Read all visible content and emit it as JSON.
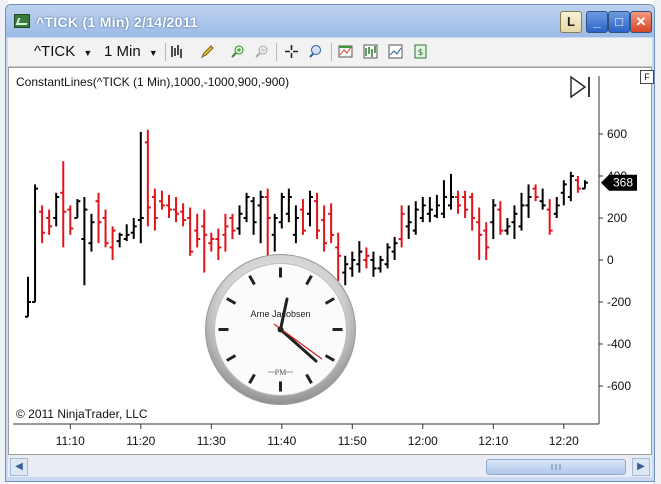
{
  "window": {
    "title": "^TICK (1 Min)  2/14/2011",
    "buttons": {
      "l": "L",
      "minimize": "_",
      "maximize": "□",
      "close": "✕"
    }
  },
  "toolbar": {
    "instrument": "^TICK",
    "interval": "1 Min",
    "icons": [
      "bar-type-icon",
      "drawing-pencil-icon",
      "zoom-in-icon",
      "zoom-out-icon",
      "crosshair-icon",
      "magnifier-icon",
      "indicators-icon",
      "strategies-icon",
      "chart-properties-icon",
      "data-box-icon"
    ]
  },
  "chart": {
    "indicator_label": "ConstantLines(^TICK  (1  Min),1000,-1000,900,-900)",
    "copyright": "© 2011 NinjaTrader, LLC",
    "f_button": "F",
    "last_price_label": "368",
    "play_icon": "play-to-end-icon"
  },
  "clock": {
    "brand": "Arne Jacobsen",
    "meridiem": "PM"
  },
  "colors": {
    "up_bar": "#000000",
    "down_bar": "#e0141b",
    "last_price_bg": "#000000"
  },
  "chart_data": {
    "type": "bar",
    "ylim": [
      -800,
      800
    ],
    "yticks": [
      600,
      400,
      200,
      0,
      -200,
      -400,
      -600
    ],
    "y_tick_labels": [
      "600",
      "400",
      "200",
      "0",
      "-200",
      "-400",
      "-600"
    ],
    "x_tick_labels": [
      "11:10",
      "11:20",
      "11:30",
      "11:40",
      "11:50",
      "12:00",
      "12:10",
      "12:20"
    ],
    "ohlc": [
      {
        "x": 0,
        "o": -270,
        "h": -80,
        "l": -270,
        "c": -200,
        "up": true
      },
      {
        "x": 1,
        "o": -200,
        "h": 360,
        "l": -200,
        "c": 340,
        "up": true
      },
      {
        "x": 2,
        "o": 230,
        "h": 260,
        "l": 80,
        "c": 130,
        "up": false
      },
      {
        "x": 3,
        "o": 200,
        "h": 240,
        "l": 120,
        "c": 160,
        "up": false
      },
      {
        "x": 4,
        "o": 200,
        "h": 320,
        "l": 160,
        "c": 300,
        "up": true
      },
      {
        "x": 5,
        "o": 320,
        "h": 470,
        "l": 60,
        "c": 230,
        "up": false
      },
      {
        "x": 6,
        "o": 240,
        "h": 260,
        "l": 120,
        "c": 150,
        "up": false
      },
      {
        "x": 7,
        "o": 200,
        "h": 290,
        "l": 200,
        "c": 280,
        "up": true
      },
      {
        "x": 8,
        "o": 100,
        "h": 300,
        "l": -120,
        "c": 240,
        "up": true
      },
      {
        "x": 9,
        "o": 80,
        "h": 220,
        "l": 40,
        "c": 180,
        "up": true
      },
      {
        "x": 10,
        "o": 280,
        "h": 320,
        "l": 80,
        "c": 180,
        "up": false
      },
      {
        "x": 11,
        "o": 200,
        "h": 240,
        "l": 60,
        "c": 80,
        "up": false
      },
      {
        "x": 12,
        "o": 60,
        "h": 160,
        "l": 0,
        "c": 140,
        "up": false
      },
      {
        "x": 13,
        "o": 90,
        "h": 130,
        "l": 60,
        "c": 120,
        "up": true
      },
      {
        "x": 14,
        "o": 100,
        "h": 170,
        "l": 90,
        "c": 120,
        "up": true
      },
      {
        "x": 15,
        "o": 130,
        "h": 200,
        "l": 100,
        "c": 160,
        "up": true
      },
      {
        "x": 16,
        "o": 190,
        "h": 610,
        "l": 80,
        "c": 200,
        "up": true
      },
      {
        "x": 17,
        "o": 560,
        "h": 620,
        "l": 160,
        "c": 250,
        "up": false
      },
      {
        "x": 18,
        "o": 300,
        "h": 340,
        "l": 140,
        "c": 200,
        "up": false
      },
      {
        "x": 19,
        "o": 280,
        "h": 330,
        "l": 240,
        "c": 260,
        "up": false
      },
      {
        "x": 20,
        "o": 260,
        "h": 310,
        "l": 200,
        "c": 240,
        "up": false
      },
      {
        "x": 21,
        "o": 240,
        "h": 300,
        "l": 180,
        "c": 220,
        "up": false
      },
      {
        "x": 22,
        "o": 230,
        "h": 270,
        "l": 160,
        "c": 190,
        "up": false
      },
      {
        "x": 23,
        "o": 200,
        "h": 250,
        "l": 20,
        "c": 40,
        "up": false
      },
      {
        "x": 24,
        "o": 140,
        "h": 220,
        "l": 60,
        "c": 100,
        "up": false
      },
      {
        "x": 25,
        "o": 160,
        "h": 240,
        "l": -60,
        "c": 120,
        "up": false
      },
      {
        "x": 26,
        "o": 80,
        "h": 130,
        "l": 40,
        "c": 100,
        "up": false
      },
      {
        "x": 27,
        "o": 100,
        "h": 150,
        "l": 0,
        "c": 60,
        "up": false
      },
      {
        "x": 28,
        "o": 120,
        "h": 220,
        "l": 40,
        "c": 160,
        "up": false
      },
      {
        "x": 29,
        "o": 200,
        "h": 220,
        "l": 100,
        "c": 140,
        "up": false
      },
      {
        "x": 30,
        "o": 150,
        "h": 260,
        "l": 120,
        "c": 220,
        "up": true
      },
      {
        "x": 31,
        "o": 200,
        "h": 320,
        "l": 180,
        "c": 300,
        "up": true
      },
      {
        "x": 32,
        "o": 280,
        "h": 300,
        "l": 120,
        "c": 180,
        "up": true
      },
      {
        "x": 33,
        "o": 260,
        "h": 330,
        "l": 80,
        "c": 300,
        "up": true
      },
      {
        "x": 34,
        "o": 300,
        "h": 340,
        "l": -60,
        "c": 200,
        "up": false
      },
      {
        "x": 35,
        "o": 120,
        "h": 220,
        "l": 40,
        "c": 200,
        "up": true
      },
      {
        "x": 36,
        "o": 180,
        "h": 320,
        "l": 150,
        "c": 300,
        "up": true
      },
      {
        "x": 37,
        "o": 220,
        "h": 340,
        "l": 180,
        "c": 300,
        "up": true
      },
      {
        "x": 38,
        "o": 120,
        "h": 260,
        "l": 80,
        "c": 200,
        "up": true
      },
      {
        "x": 39,
        "o": 240,
        "h": 290,
        "l": 120,
        "c": 140,
        "up": false
      },
      {
        "x": 40,
        "o": 220,
        "h": 330,
        "l": 160,
        "c": 300,
        "up": true
      },
      {
        "x": 41,
        "o": 280,
        "h": 320,
        "l": 100,
        "c": 140,
        "up": false
      },
      {
        "x": 42,
        "o": 190,
        "h": 260,
        "l": 40,
        "c": 80,
        "up": false
      },
      {
        "x": 43,
        "o": 220,
        "h": 270,
        "l": 80,
        "c": 120,
        "up": false
      },
      {
        "x": 44,
        "o": 60,
        "h": 130,
        "l": -100,
        "c": 20,
        "up": false
      },
      {
        "x": 45,
        "o": -60,
        "h": 20,
        "l": -120,
        "c": -20,
        "up": true
      },
      {
        "x": 46,
        "o": -40,
        "h": 40,
        "l": -80,
        "c": 0,
        "up": true
      },
      {
        "x": 47,
        "o": -20,
        "h": 90,
        "l": -60,
        "c": 40,
        "up": true
      },
      {
        "x": 48,
        "o": 0,
        "h": 60,
        "l": -40,
        "c": 20,
        "up": false
      },
      {
        "x": 49,
        "o": 0,
        "h": 40,
        "l": -80,
        "c": -40,
        "up": true
      },
      {
        "x": 50,
        "o": -40,
        "h": 20,
        "l": -60,
        "c": 0,
        "up": true
      },
      {
        "x": 51,
        "o": -20,
        "h": 80,
        "l": -40,
        "c": 60,
        "up": true
      },
      {
        "x": 52,
        "o": 40,
        "h": 110,
        "l": 0,
        "c": 80,
        "up": true
      },
      {
        "x": 53,
        "o": 100,
        "h": 260,
        "l": 60,
        "c": 220,
        "up": false
      },
      {
        "x": 54,
        "o": 160,
        "h": 260,
        "l": 100,
        "c": 180,
        "up": true
      },
      {
        "x": 55,
        "o": 140,
        "h": 280,
        "l": 120,
        "c": 240,
        "up": true
      },
      {
        "x": 56,
        "o": 200,
        "h": 300,
        "l": 180,
        "c": 260,
        "up": true
      },
      {
        "x": 57,
        "o": 220,
        "h": 300,
        "l": 180,
        "c": 240,
        "up": true
      },
      {
        "x": 58,
        "o": 210,
        "h": 310,
        "l": 200,
        "c": 260,
        "up": true
      },
      {
        "x": 59,
        "o": 220,
        "h": 380,
        "l": 200,
        "c": 300,
        "up": true
      },
      {
        "x": 60,
        "o": 260,
        "h": 410,
        "l": 240,
        "c": 300,
        "up": true
      },
      {
        "x": 61,
        "o": 300,
        "h": 330,
        "l": 220,
        "c": 260,
        "up": false
      },
      {
        "x": 62,
        "o": 300,
        "h": 330,
        "l": 200,
        "c": 240,
        "up": false
      },
      {
        "x": 63,
        "o": 300,
        "h": 320,
        "l": 140,
        "c": 200,
        "up": false
      },
      {
        "x": 64,
        "o": 180,
        "h": 250,
        "l": 0,
        "c": 120,
        "up": false
      },
      {
        "x": 65,
        "o": 140,
        "h": 180,
        "l": 0,
        "c": 60,
        "up": false
      },
      {
        "x": 66,
        "o": 180,
        "h": 290,
        "l": 100,
        "c": 260,
        "up": true
      },
      {
        "x": 67,
        "o": 240,
        "h": 280,
        "l": 120,
        "c": 140,
        "up": false
      },
      {
        "x": 68,
        "o": 140,
        "h": 200,
        "l": 120,
        "c": 160,
        "up": true
      },
      {
        "x": 69,
        "o": 180,
        "h": 260,
        "l": 100,
        "c": 220,
        "up": true
      },
      {
        "x": 70,
        "o": 160,
        "h": 320,
        "l": 140,
        "c": 260,
        "up": true
      },
      {
        "x": 71,
        "o": 260,
        "h": 360,
        "l": 200,
        "c": 300,
        "up": true
      },
      {
        "x": 72,
        "o": 340,
        "h": 360,
        "l": 280,
        "c": 300,
        "up": false
      },
      {
        "x": 73,
        "o": 280,
        "h": 340,
        "l": 240,
        "c": 260,
        "up": true
      },
      {
        "x": 74,
        "o": 240,
        "h": 290,
        "l": 120,
        "c": 140,
        "up": false
      },
      {
        "x": 75,
        "o": 220,
        "h": 300,
        "l": 200,
        "c": 260,
        "up": true
      },
      {
        "x": 76,
        "o": 320,
        "h": 380,
        "l": 260,
        "c": 360,
        "up": true
      },
      {
        "x": 77,
        "o": 300,
        "h": 420,
        "l": 280,
        "c": 400,
        "up": true
      },
      {
        "x": 78,
        "o": 380,
        "h": 400,
        "l": 320,
        "c": 340,
        "up": false
      },
      {
        "x": 79,
        "o": 340,
        "h": 380,
        "l": 340,
        "c": 368,
        "up": true
      }
    ]
  }
}
